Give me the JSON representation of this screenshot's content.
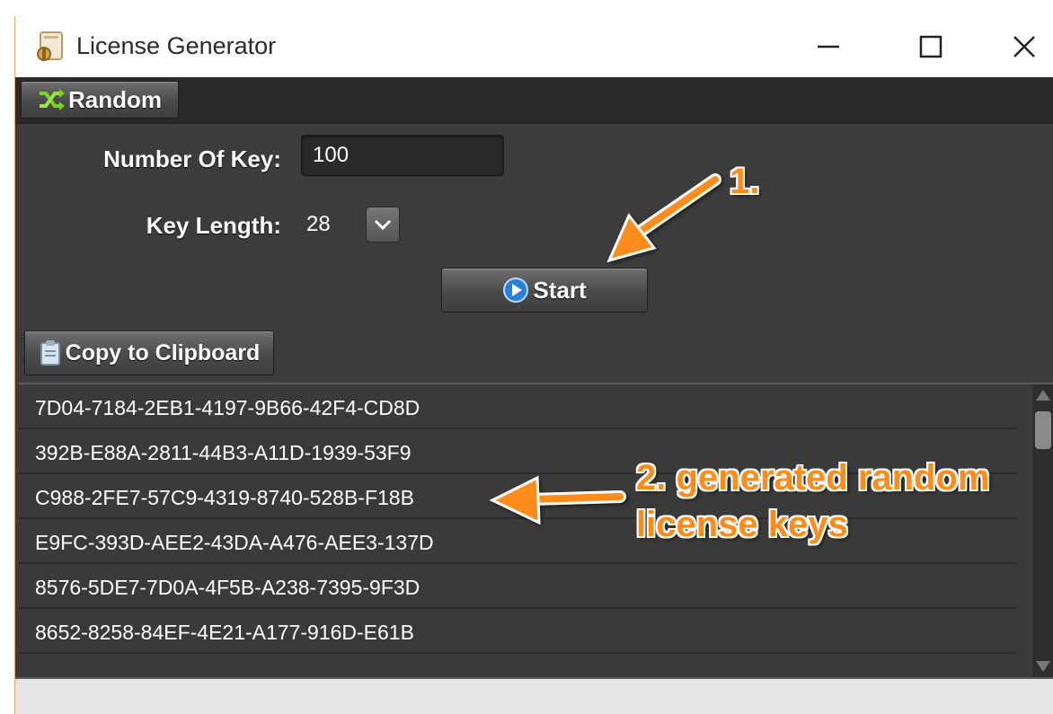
{
  "window": {
    "title": "License Generator",
    "controls": [
      "minimize-icon",
      "maximize-icon",
      "close-icon"
    ]
  },
  "toolbar": {
    "random_label": "Random",
    "random_icon": "shuffle-icon"
  },
  "form": {
    "number_of_key_label": "Number Of Key:",
    "number_of_key_value": "100",
    "key_length_label": "Key Length:",
    "key_length_value": "28",
    "start_label": "Start",
    "start_icon": "play-icon",
    "copy_label": "Copy to Clipboard",
    "copy_icon": "clipboard-icon"
  },
  "keys": [
    "7D04-7184-2EB1-4197-9B66-42F4-CD8D",
    "392B-E88A-2811-44B3-A11D-1939-53F9",
    "C988-2FE7-57C9-4319-8740-528B-F18B",
    "E9FC-393D-AEE2-43DA-A476-AEE3-137D",
    "8576-5DE7-7D0A-4F5B-A238-7395-9F3D",
    "8652-8258-84EF-4E21-A177-916D-E61B"
  ],
  "annotations": {
    "step1": "1.",
    "step2_line1": "2. generated random",
    "step2_line2": "license keys"
  },
  "colors": {
    "annotation": "#ff8c1a",
    "window_bg": "#3c3c3c",
    "titlebar_bg": "#ffffff"
  }
}
